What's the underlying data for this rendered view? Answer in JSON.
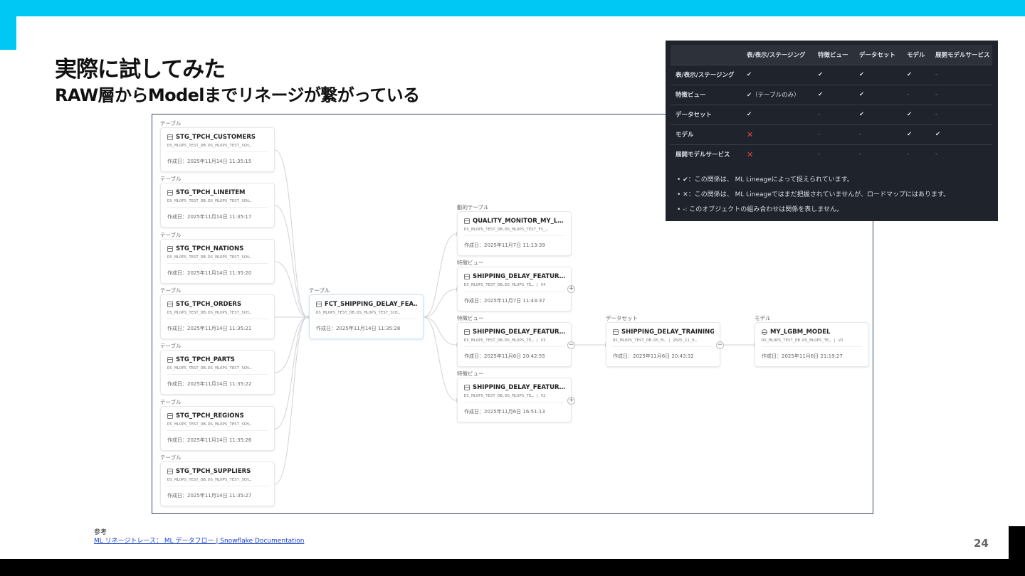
{
  "slide": {
    "title": "実際に試してみた",
    "subtitle": "RAW層からModelまでリネージが繋がっている",
    "reference_label": "参考",
    "reference_link": "ML リネージトレース： ML データフロー | Snowflake Documentation",
    "page_number": "24"
  },
  "lineage": {
    "tables": [
      {
        "group": "テーブル",
        "name": "STG_TPCH_CUSTOMERS",
        "path": "DS_MLOPS_TEST_DB.DS_MLOPS_TEST_SCH…",
        "date": "作成日：2025年11月14日 11:35:15"
      },
      {
        "group": "テーブル",
        "name": "STG_TPCH_LINEITEM",
        "path": "DS_MLOPS_TEST_DB.DS_MLOPS_TEST_SCH…",
        "date": "作成日：2025年11月14日 11:35:17"
      },
      {
        "group": "テーブル",
        "name": "STG_TPCH_NATIONS",
        "path": "DS_MLOPS_TEST_DB.DS_MLOPS_TEST_SCH…",
        "date": "作成日：2025年11月14日 11:35:20"
      },
      {
        "group": "テーブル",
        "name": "STG_TPCH_ORDERS",
        "path": "DS_MLOPS_TEST_DB.DS_MLOPS_TEST_SCH…",
        "date": "作成日：2025年11月14日 11:35:21"
      },
      {
        "group": "テーブル",
        "name": "STG_TPCH_PARTS",
        "path": "DS_MLOPS_TEST_DB.DS_MLOPS_TEST_SCH…",
        "date": "作成日：2025年11月14日 11:35:22"
      },
      {
        "group": "テーブル",
        "name": "STG_TPCH_REGIONS",
        "path": "DS_MLOPS_TEST_DB.DS_MLOPS_TEST_SCH…",
        "date": "作成日：2025年11月14日 11:35:26"
      },
      {
        "group": "テーブル",
        "name": "STG_TPCH_SUPPLIERS",
        "path": "DS_MLOPS_TEST_DB.DS_MLOPS_TEST_SCH…",
        "date": "作成日：2025年11月14日 11:35:27"
      }
    ],
    "fact": {
      "group": "テーブル",
      "name": "FCT_SHIPPING_DELAY_FEA…",
      "path": "DS_MLOPS_TEST_DB.DS_MLOPS_TEST_SCH…",
      "date": "作成日：2025年11月14日 11:35:28"
    },
    "features": [
      {
        "group": "動的テーブル",
        "name": "QUALITY_MONITOR_MY_L…",
        "path": "DS_MLOPS_TEST_DB.DS_MLOPS_TEST_FS_…",
        "date": "作成日：2025年11月7日 11:13:39"
      },
      {
        "group": "特徴ビュー",
        "name": "SHIPPING_DELAY_FEATUR…",
        "path": "DS_MLOPS_TEST_DB.DS_MLOPS_TE…  |  V4",
        "date": "作成日：2025年11月7日 11:44:37"
      },
      {
        "group": "特徴ビュー",
        "name": "SHIPPING_DELAY_FEATUR…",
        "path": "DS_MLOPS_TEST_DB.DS_MLOPS_TE…  |  V3",
        "date": "作成日：2025年11月6日 20:42:55"
      },
      {
        "group": "特徴ビュー",
        "name": "SHIPPING_DELAY_FEATUR…",
        "path": "DS_MLOPS_TEST_DB.DS_MLOPS_TE…  |  V2",
        "date": "作成日：2025年11月6日 16:51:13"
      }
    ],
    "dataset": {
      "group": "データセット",
      "name": "SHIPPING_DELAY_TRAINING_D…",
      "path": "DS_MLOPS_TEST_DB.DS_M…  |  2025_11_0…",
      "date": "作成日：2025年11月6日 20:43:32"
    },
    "model": {
      "group": "モデル",
      "name": "MY_LGBM_MODEL",
      "path": "DS_MLOPS_TEST_DB.DS_MLOPS_TE…  |  V2",
      "date": "作成日：2025年11月6日 21:19:27"
    },
    "expand_plus": "+",
    "collapse_minus": "−"
  },
  "legend_table": {
    "columns": [
      "",
      "表/表示/ステージング",
      "特徴ビュー",
      "データセット",
      "モデル",
      "展開モデルサービス"
    ],
    "rows": [
      {
        "label": "表/表示/ステージング",
        "cells": [
          "✔",
          "✔",
          "✔",
          "✔",
          "-"
        ]
      },
      {
        "label": "特徴ビュー",
        "cells": [
          "✔（テーブルのみ）",
          "✔",
          "✔",
          "-",
          "-"
        ]
      },
      {
        "label": "データセット",
        "cells": [
          "✔",
          "-",
          "✔",
          "✔",
          "-"
        ]
      },
      {
        "label": "モデル",
        "cells": [
          "✕",
          "-",
          "-",
          "✔",
          "✔"
        ]
      },
      {
        "label": "展開モデルサービス",
        "cells": [
          "✕",
          "-",
          "-",
          "-",
          "-"
        ]
      }
    ],
    "notes": [
      "•  ✔：この関係は、 ML Lineageによって捉えられています。",
      "•  ✕：この関係は、 ML Lineageではまだ把握されていませんが、ロードマップにはあります。",
      "•  -: このオブジェクトの組み合わせは関係を表しません。"
    ],
    "colors": {
      "check": "#d9dde3",
      "cross": "#e5483d",
      "background": "#1f232b"
    }
  }
}
